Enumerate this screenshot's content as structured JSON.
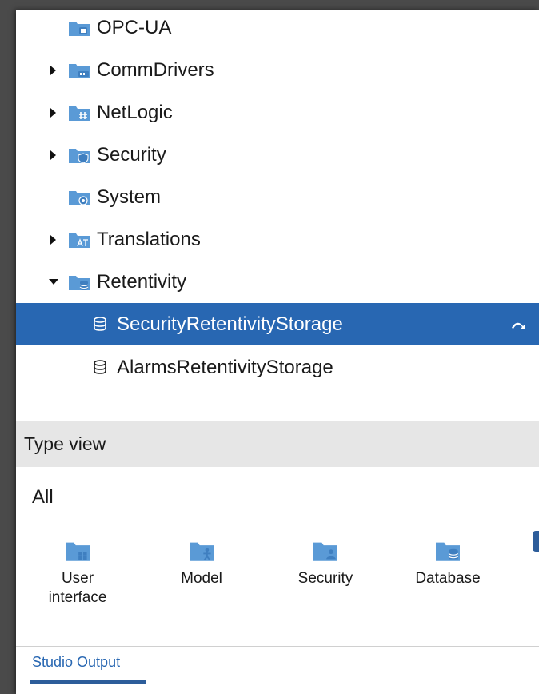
{
  "tree": {
    "items": [
      {
        "label": "OPC-UA",
        "icon": "opcua-folder-icon",
        "expander": "none"
      },
      {
        "label": "CommDrivers",
        "icon": "commdrivers-folder-icon",
        "expander": "collapsed"
      },
      {
        "label": "NetLogic",
        "icon": "netlogic-folder-icon",
        "expander": "collapsed"
      },
      {
        "label": "Security",
        "icon": "security-folder-icon",
        "expander": "collapsed"
      },
      {
        "label": "System",
        "icon": "system-folder-icon",
        "expander": "none"
      },
      {
        "label": "Translations",
        "icon": "translations-folder-icon",
        "expander": "collapsed"
      },
      {
        "label": "Retentivity",
        "icon": "retentivity-folder-icon",
        "expander": "expanded"
      },
      {
        "label": "SecurityRetentivityStorage",
        "icon": "storage-icon",
        "selected": true
      },
      {
        "label": "AlarmsRetentivityStorage",
        "icon": "storage-icon"
      }
    ]
  },
  "type_view": {
    "title": "Type view",
    "filter": "All",
    "items": [
      {
        "label_line1": "User",
        "label_line2": "interface",
        "icon": "user-interface-folder-icon"
      },
      {
        "label_line1": "Model",
        "icon": "model-folder-icon"
      },
      {
        "label_line1": "Security",
        "icon": "security-folder-icon"
      },
      {
        "label_line1": "Database",
        "icon": "database-folder-icon"
      }
    ]
  },
  "bottom_panel": {
    "tab_label": "Studio Output"
  },
  "colors": {
    "selection": "#2867b2",
    "folder": "#5a9ad6",
    "folder_dark": "#3f7fc0",
    "header_bg": "#e6e6e6"
  }
}
